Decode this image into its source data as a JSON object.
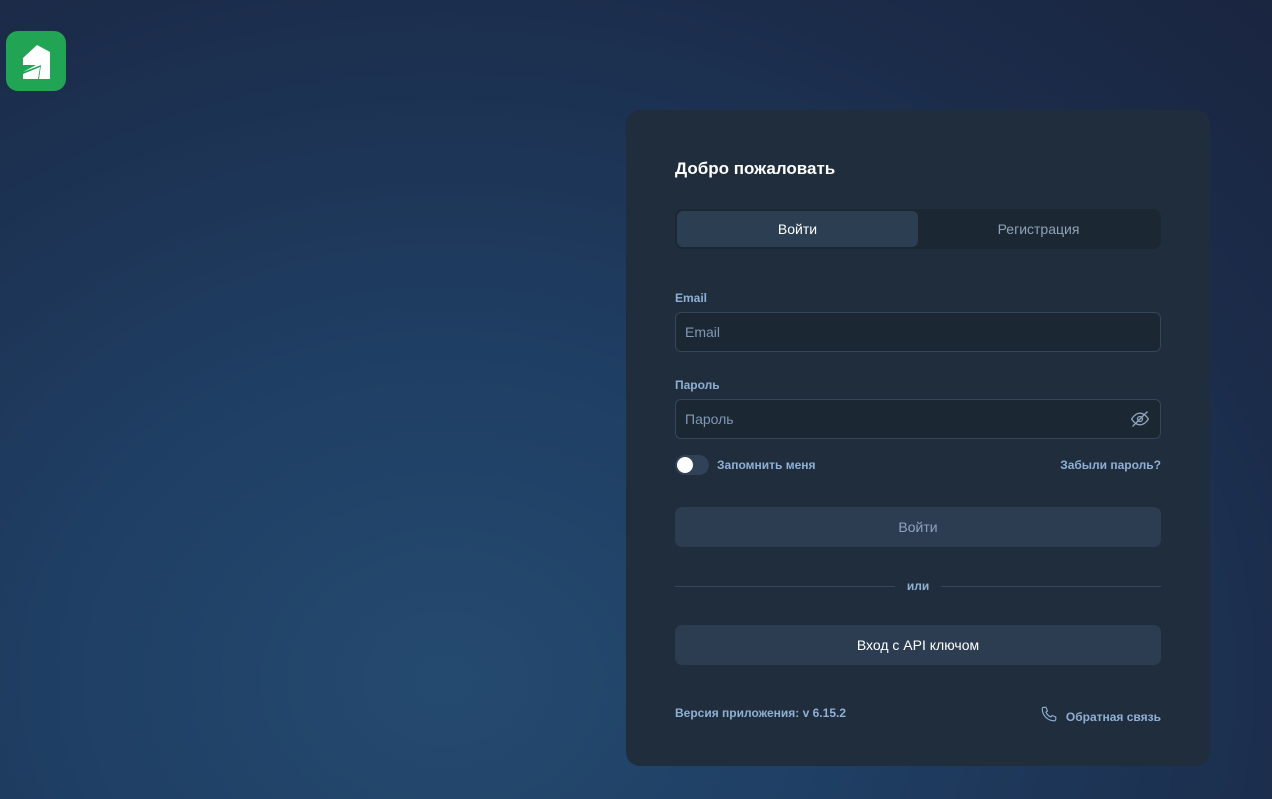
{
  "header": {
    "logo_icon": "app-logo"
  },
  "login": {
    "title": "Добро пожаловать",
    "tabs": [
      {
        "label": "Войти",
        "active": true
      },
      {
        "label": "Регистрация",
        "active": false
      }
    ],
    "email": {
      "label": "Email",
      "placeholder": "Email",
      "value": ""
    },
    "password": {
      "label": "Пароль",
      "placeholder": "Пароль",
      "value": "",
      "icon": "eye-off-icon"
    },
    "remember_label": "Запомнить меня",
    "remember_checked": false,
    "forgot_link": "Забыли пароль?",
    "submit_label": "Войти",
    "divider_text": "или",
    "api_key_label": "Вход с API ключом",
    "version_text": "Версия приложения: v 6.15.2",
    "feedback_label": "Обратная связь",
    "feedback_icon": "phone-icon"
  },
  "colors": {
    "brand": "#22a455",
    "card": "#1f2d3d"
  }
}
